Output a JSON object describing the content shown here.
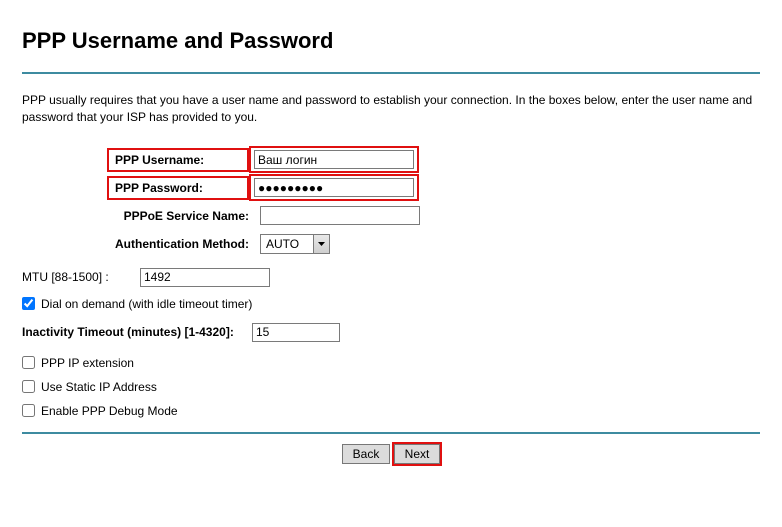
{
  "title": "PPP Username and Password",
  "intro": "PPP usually requires that you have a user name and password to establish your connection. In the boxes below, enter the user name and password that your ISP has provided to you.",
  "labels": {
    "username": "PPP Username:",
    "password": "PPP Password:",
    "service_name": "PPPoE Service Name:",
    "auth_method": "Authentication Method:",
    "mtu": "MTU [88-1500] :",
    "dial_on_demand": "Dial on demand (with idle timeout timer)",
    "inactivity": "Inactivity Timeout (minutes) [1-4320]:",
    "ppp_ip_ext": "PPP IP extension",
    "use_static_ip": "Use Static IP Address",
    "debug_mode": "Enable PPP Debug Mode"
  },
  "values": {
    "username": "Ваш логин",
    "password": "●●●●●●●●●",
    "service_name": "",
    "auth_method": "AUTO",
    "mtu": "1492",
    "dial_on_demand": true,
    "inactivity": "15",
    "ppp_ip_ext": false,
    "use_static_ip": false,
    "debug_mode": false
  },
  "buttons": {
    "back": "Back",
    "next": "Next"
  }
}
